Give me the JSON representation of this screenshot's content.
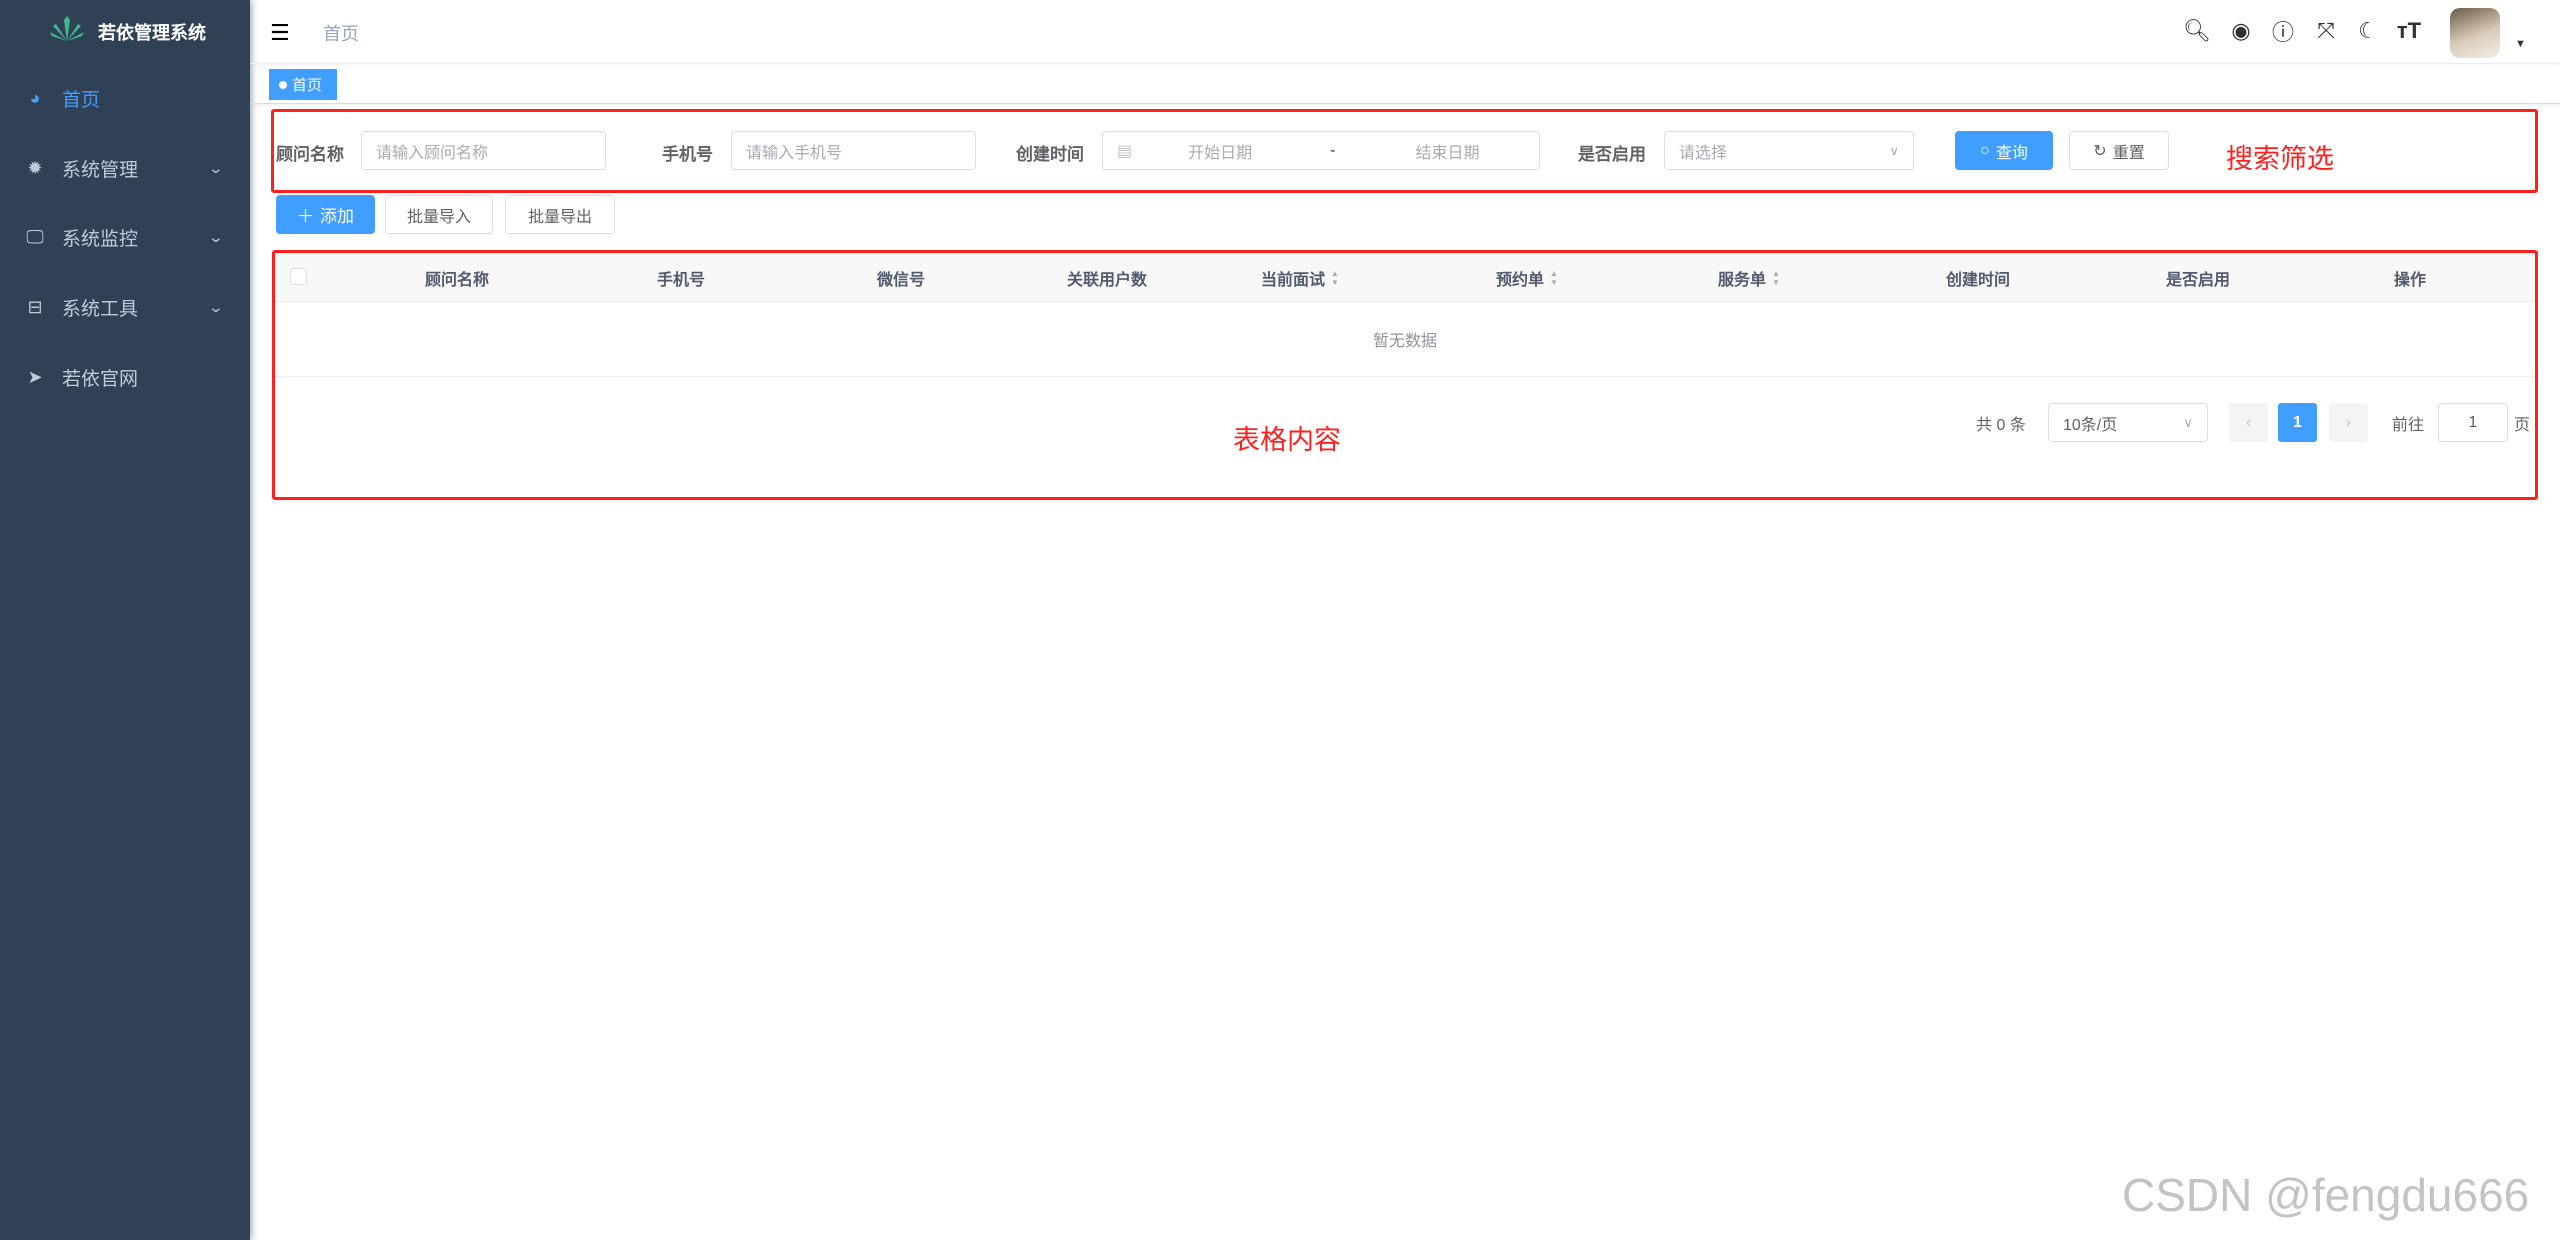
{
  "sidebar": {
    "logo_title": "若依管理系统",
    "items": [
      {
        "label": "首页",
        "icon": "dashboard-icon",
        "active": true
      },
      {
        "label": "系统管理",
        "icon": "gear-icon",
        "expandable": true
      },
      {
        "label": "系统监控",
        "icon": "monitor-icon",
        "expandable": true
      },
      {
        "label": "系统工具",
        "icon": "toolbox-icon",
        "expandable": true
      },
      {
        "label": "若依官网",
        "icon": "paper-plane-icon"
      }
    ]
  },
  "header": {
    "breadcrumb": "首页",
    "icons": [
      "search-icon",
      "github-icon",
      "help-icon",
      "fullscreen-icon",
      "moon-icon",
      "font-size-icon"
    ]
  },
  "tags": [
    {
      "label": "首页",
      "active": true
    }
  ],
  "search": {
    "advisor_name": {
      "label": "顾问名称",
      "placeholder": "请输入顾问名称"
    },
    "phone": {
      "label": "手机号",
      "placeholder": "请输入手机号"
    },
    "created_time": {
      "label": "创建时间",
      "start_placeholder": "开始日期",
      "separator": "-",
      "end_placeholder": "结束日期"
    },
    "enabled": {
      "label": "是否启用",
      "placeholder": "请选择"
    },
    "query_label": "查询",
    "reset_label": "重置",
    "annotation": "搜索筛选"
  },
  "toolbar": {
    "add_label": "添加",
    "import_label": "批量导入",
    "export_label": "批量导出"
  },
  "table": {
    "columns": [
      {
        "label": "顾问名称"
      },
      {
        "label": "手机号"
      },
      {
        "label": "微信号"
      },
      {
        "label": "关联用户数"
      },
      {
        "label": "当前面试",
        "sortable": true
      },
      {
        "label": "预约单",
        "sortable": true
      },
      {
        "label": "服务单",
        "sortable": true
      },
      {
        "label": "创建时间"
      },
      {
        "label": "是否启用"
      },
      {
        "label": "操作"
      }
    ],
    "empty_text": "暂无数据",
    "annotation": "表格内容"
  },
  "pagination": {
    "total_text": "共 0 条",
    "page_size": "10条/页",
    "current_page": "1",
    "goto_label": "前往",
    "goto_value": "1",
    "page_suffix": "页"
  },
  "watermark": "CSDN @fengdu666",
  "colors": {
    "sidebar_bg": "#304156",
    "primary": "#409eff",
    "annotation_red": "#ff1f1f"
  }
}
